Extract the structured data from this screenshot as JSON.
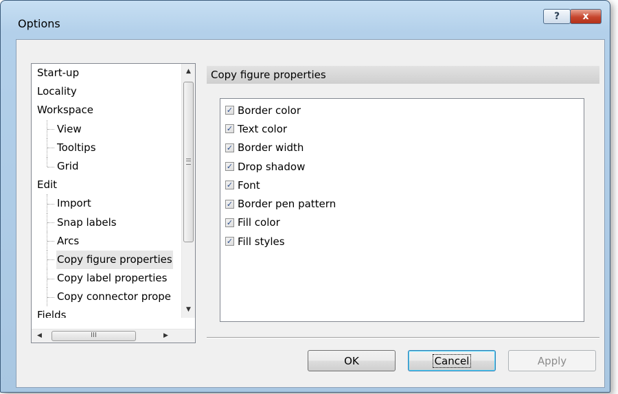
{
  "window": {
    "title": "Options",
    "help_symbol": "?",
    "close_symbol": "x"
  },
  "tree": {
    "items": [
      {
        "label": "Start-up",
        "level": 0
      },
      {
        "label": "Locality",
        "level": 0
      },
      {
        "label": "Workspace",
        "level": 0
      },
      {
        "label": "View",
        "level": 1
      },
      {
        "label": "Tooltips",
        "level": 1
      },
      {
        "label": "Grid",
        "level": 1,
        "last": true
      },
      {
        "label": "Edit",
        "level": 0
      },
      {
        "label": "Import",
        "level": 1
      },
      {
        "label": "Snap labels",
        "level": 1
      },
      {
        "label": "Arcs",
        "level": 1
      },
      {
        "label": "Copy figure properties",
        "level": 1,
        "selected": true
      },
      {
        "label": "Copy label properties",
        "level": 1
      },
      {
        "label": "Copy connector prope",
        "level": 1
      },
      {
        "label": "Fields",
        "level": 0
      }
    ],
    "scroll_up": "▲",
    "scroll_down": "▼",
    "scroll_left": "◀",
    "scroll_right": "▶",
    "hthumb_grip": "III"
  },
  "panel": {
    "header": "Copy figure properties",
    "checkboxes": [
      {
        "label": "Border color",
        "checked": true
      },
      {
        "label": "Text color",
        "checked": true
      },
      {
        "label": "Border width",
        "checked": true
      },
      {
        "label": "Drop shadow",
        "checked": true
      },
      {
        "label": "Font",
        "checked": true
      },
      {
        "label": "Border pen pattern",
        "checked": true
      },
      {
        "label": "Fill color",
        "checked": true
      },
      {
        "label": "Fill styles",
        "checked": true
      }
    ],
    "check_mark": "✓"
  },
  "buttons": {
    "ok": "OK",
    "cancel": "Cancel",
    "apply": "Apply"
  }
}
